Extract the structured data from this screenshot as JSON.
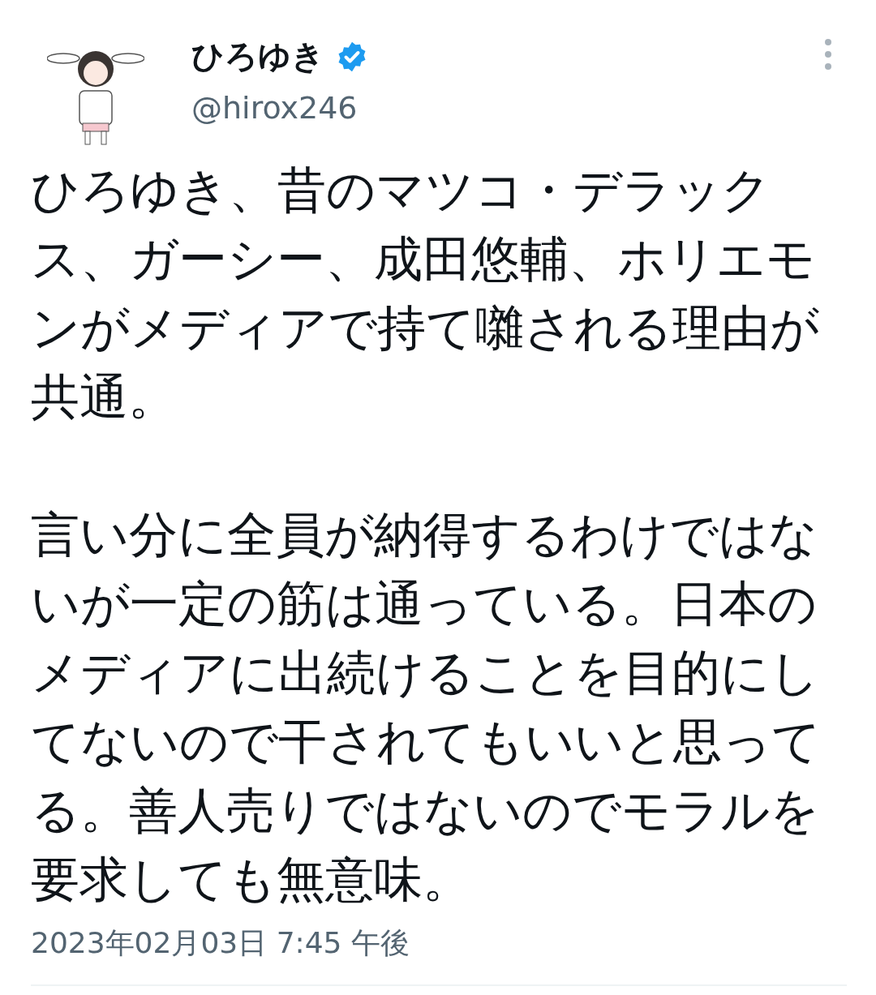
{
  "tweet": {
    "author": {
      "name": "ひろゆき",
      "verified": true,
      "handle": "@hirox246"
    },
    "paragraphs": [
      "ひろゆき、昔のマツコ・デラックス、ガーシー、成田悠輔、ホリエモンがメディアで持て囃される理由が共通。",
      "言い分に全員が納得するわけではないが一定の筋は通っている。日本のメディアに出続けることを目的にしてないので干されてもいいと思ってる。善人売りではないのでモラルを要求しても無意味。"
    ],
    "timestamp": "2023年02月03日 7:45 午後"
  }
}
